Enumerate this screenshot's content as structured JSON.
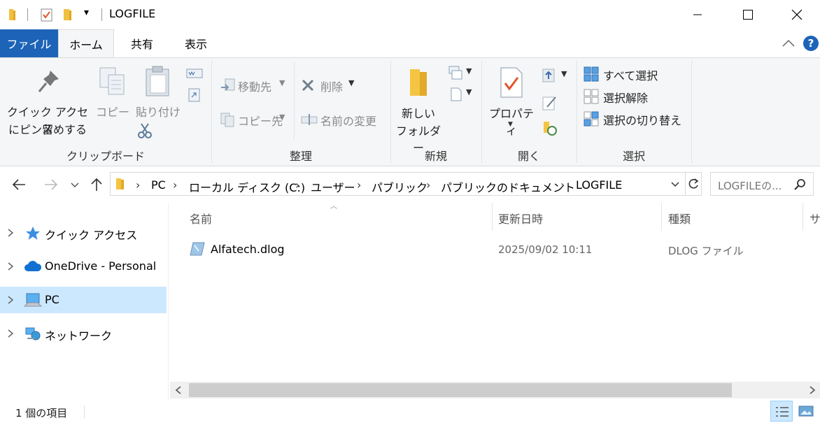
{
  "window": {
    "title": "LOGFILE",
    "qat_dropdown": "▾"
  },
  "tabs": {
    "file": "ファイル",
    "home": "ホーム",
    "share": "共有",
    "view": "表示"
  },
  "ribbon": {
    "clipboard": {
      "pin_line1": "クイック アクセス",
      "pin_line2": "にピン留めする",
      "copy": "コピー",
      "paste": "貼り付け",
      "label": "クリップボード"
    },
    "organize": {
      "move_to": "移動先",
      "copy_to": "コピー先",
      "delete": "削除",
      "rename": "名前の変更",
      "label": "整理"
    },
    "new": {
      "new_folder_line1": "新しい",
      "new_folder_line2": "フォルダー",
      "label": "新規"
    },
    "open": {
      "properties": "プロパティ",
      "label": "開く"
    },
    "select": {
      "select_all": "すべて選択",
      "select_none": "選択解除",
      "invert": "選択の切り替え",
      "label": "選択"
    }
  },
  "address": {
    "crumbs": [
      "PC",
      "ローカル ディスク (C:)",
      "ユーザー",
      "パブリック",
      "パブリックのドキュメント",
      "LOGFILE"
    ],
    "search_placeholder": "LOGFILEの..."
  },
  "nav": {
    "items": [
      {
        "label": "クイック アクセス",
        "icon": "star-icon"
      },
      {
        "label": "OneDrive - Personal",
        "icon": "cloud-icon"
      },
      {
        "label": "PC",
        "icon": "computer-icon",
        "selected": true
      },
      {
        "label": "ネットワーク",
        "icon": "network-icon"
      }
    ]
  },
  "list": {
    "columns": [
      "名前",
      "更新日時",
      "種類",
      "サ"
    ],
    "rows": [
      {
        "name": "Alfatech.dlog",
        "modified": "2025/09/02 10:11",
        "type": "DLOG ファイル"
      }
    ]
  },
  "status": {
    "count": "1 個の項目"
  },
  "colors": {
    "file_tab": "#1d64b8",
    "selection": "#cce8ff",
    "ribbon_bg": "#f5f6f7",
    "folder": "#f4c542"
  }
}
